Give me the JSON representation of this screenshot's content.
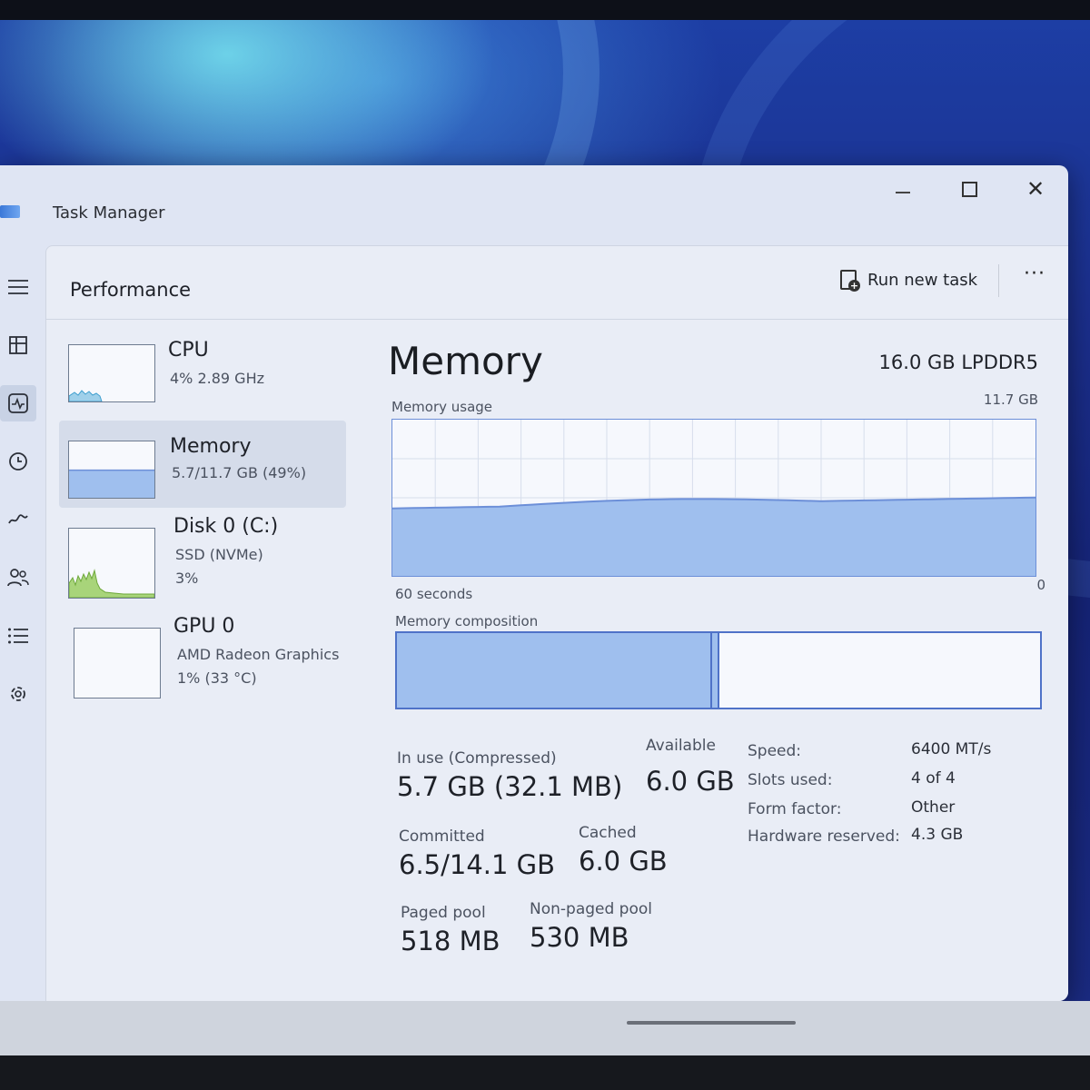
{
  "window": {
    "title": "Task Manager",
    "controls": {
      "minimize": "minimize",
      "maximize": "maximize",
      "close": "✕"
    }
  },
  "nav": {
    "items": [
      {
        "icon": "hamburger-menu-icon"
      },
      {
        "icon": "processes-icon"
      },
      {
        "icon": "performance-icon",
        "active": true
      },
      {
        "icon": "app-history-icon"
      },
      {
        "icon": "startup-apps-icon"
      },
      {
        "icon": "users-icon"
      },
      {
        "icon": "details-icon"
      },
      {
        "icon": "services-icon"
      }
    ],
    "settings_icon": "settings-icon"
  },
  "header": {
    "title": "Performance",
    "run_new_task": "Run new task",
    "more": "···"
  },
  "devices": [
    {
      "name": "CPU",
      "line1": "4%  2.89 GHz",
      "line2": ""
    },
    {
      "name": "Memory",
      "line1": "5.7/11.7 GB (49%)",
      "line2": "",
      "selected": true
    },
    {
      "name": "Disk 0 (C:)",
      "line1": "SSD (NVMe)",
      "line2": "3%"
    },
    {
      "name": "GPU 0",
      "line1": "AMD Radeon Graphics",
      "line2": "1%  (33 °C)"
    }
  ],
  "memory": {
    "title": "Memory",
    "spec": "16.0 GB LPDDR5",
    "usage_label": "Memory usage",
    "usage_max": "11.7 GB",
    "time_label": "60 seconds",
    "min_label": "0",
    "composition_label": "Memory composition",
    "usage_fraction": 0.49,
    "composition_in_use_fraction": 0.49,
    "stats": {
      "in_use_label": "In use (Compressed)",
      "in_use_value": "5.7 GB (32.1 MB)",
      "available_label": "Available",
      "available_value": "6.0 GB",
      "committed_label": "Committed",
      "committed_value": "6.5/14.1 GB",
      "cached_label": "Cached",
      "cached_value": "6.0 GB",
      "paged_label": "Paged pool",
      "paged_value": "518 MB",
      "nonpaged_label": "Non-paged pool",
      "nonpaged_value": "530 MB"
    },
    "hardware": {
      "speed_label": "Speed:",
      "speed_value": "6400 MT/s",
      "slots_label": "Slots used:",
      "slots_value": "4 of 4",
      "form_label": "Form factor:",
      "form_value": "Other",
      "reserved_label": "Hardware reserved:",
      "reserved_value": "4.3 GB"
    }
  },
  "colors": {
    "accent": "#6b8fd8",
    "memory_fill": "#9fbfee",
    "memory_line": "#6c8fd8",
    "cpu_line": "#3f9fcf",
    "disk_fill": "#9fd06a"
  }
}
